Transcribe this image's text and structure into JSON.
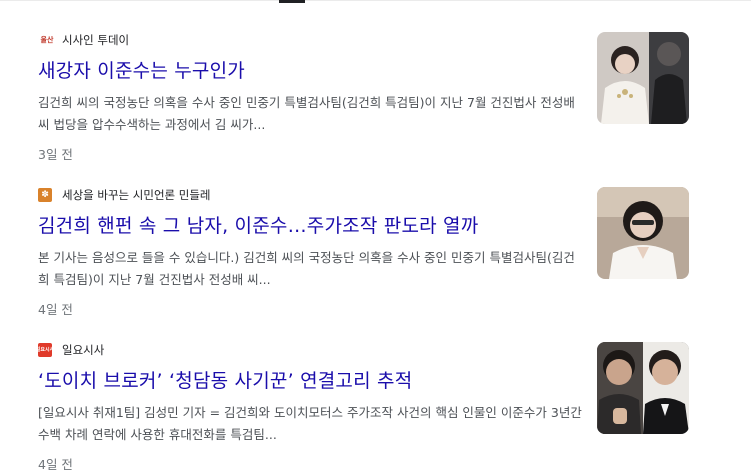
{
  "results": [
    {
      "favicon_text": "울산",
      "source": "시사인 투데이",
      "title": "새강자 이준수는 누구인가",
      "snippet": "김건희 씨의 국정농단 의혹을 수사 중인 민중기 특별검사팀(김건희 특검팀)이 지난 7월 건진법사 전성배 씨 법당을 압수수색하는 과정에서 김 씨가...",
      "age": "3일 전",
      "thumb_icon": "news-photo-thumbnail"
    },
    {
      "favicon_text": "",
      "source": "세상을 바꾸는 시민언론 민들레",
      "title": "김건희 핸펀 속 그 남자, 이준수…주가조작 판도라 열까",
      "snippet": "본 기사는 음성으로 들을 수 있습니다.) 김건희 씨의 국정농단 의혹을 수사 중인 민중기 특별검사팀(김건희 특검팀)이 지난 7월 건진법사 전성배 씨...",
      "age": "4일 전",
      "thumb_icon": "news-photo-thumbnail"
    },
    {
      "favicon_text": "일요시사",
      "source": "일요시사",
      "title": "‘도이치 브로커’ ‘청담동 사기꾼’ 연결고리 추적",
      "snippet": "[일요시사 취재1팀] 김성민 기자 = 김건희와 도이치모터스 주가조작 사건의 핵심 인물인 이준수가 3년간 수백 차례 연락에 사용한 휴대전화를 특검팀...",
      "age": "4일 전",
      "thumb_icon": "news-photo-thumbnail"
    }
  ],
  "colors": {
    "title_link": "#1a0dab",
    "snippet": "#4d5156",
    "age": "#70757a"
  }
}
